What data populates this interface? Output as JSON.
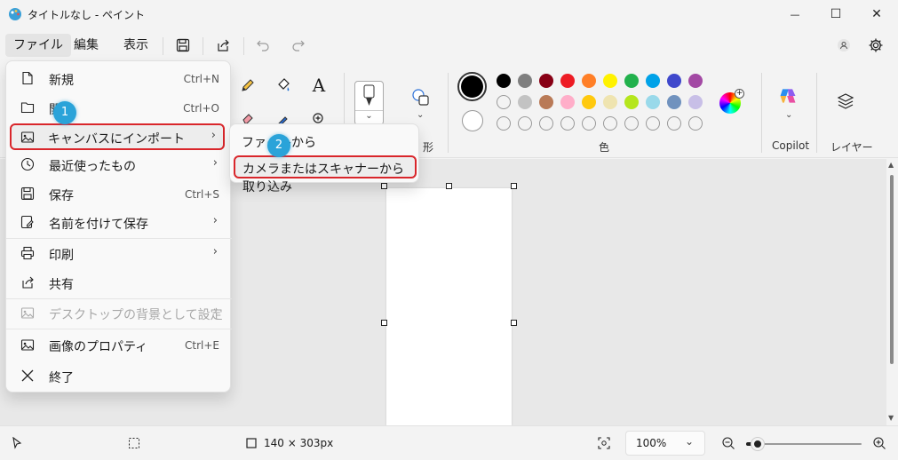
{
  "window": {
    "title": "タイトルなし - ペイント",
    "minimize_glyph": "—",
    "maximize_glyph": "☐",
    "close_glyph": "✕"
  },
  "menubar": {
    "file": "ファイル",
    "edit": "編集",
    "view": "表示"
  },
  "file_menu": {
    "items": [
      {
        "label": "新規",
        "shortcut": "Ctrl+N",
        "icon": "new-file-icon"
      },
      {
        "label": "開く",
        "shortcut": "Ctrl+O",
        "icon": "open-folder-icon"
      },
      {
        "label": "キャンバスにインポート",
        "shortcut": "",
        "icon": "import-image-icon",
        "submenu": true
      },
      {
        "label": "最近使ったもの",
        "shortcut": "",
        "icon": "clock-icon",
        "submenu": true
      },
      {
        "label": "保存",
        "shortcut": "Ctrl+S",
        "icon": "save-icon"
      },
      {
        "label": "名前を付けて保存",
        "shortcut": "",
        "icon": "save-as-icon",
        "submenu": true
      },
      {
        "label": "印刷",
        "shortcut": "",
        "icon": "print-icon",
        "submenu": true
      },
      {
        "label": "共有",
        "shortcut": "",
        "icon": "share-icon"
      },
      {
        "label": "デスクトップの背景として設定",
        "shortcut": "",
        "icon": "desktop-background-icon",
        "submenu": true,
        "disabled": true
      },
      {
        "label": "画像のプロパティ",
        "shortcut": "Ctrl+E",
        "icon": "image-properties-icon"
      },
      {
        "label": "終了",
        "shortcut": "",
        "icon": "close-icon"
      }
    ],
    "arrow_glyph": "›"
  },
  "import_submenu": {
    "from_file": "ファイルから",
    "from_camera": "カメラまたはスキャナーから取り込み"
  },
  "badges": {
    "step1": "1",
    "step2": "2"
  },
  "ribbon": {
    "shapes_label": "形",
    "colors_label": "色",
    "copilot_label": "Copilot",
    "layers_label": "レイヤー",
    "text_tool_glyph": "A"
  },
  "palette": {
    "row1": [
      "#000000",
      "#7f7f7f",
      "#880015",
      "#ed1c24",
      "#ff7f27",
      "#fff200",
      "#22b14c",
      "#00a2e8",
      "#3f48cc",
      "#a349a4"
    ],
    "row2": [
      "",
      "#c3c3c3",
      "#b97a57",
      "#ffaec9",
      "#ffc90e",
      "#efe4b0",
      "#b5e61d",
      "#99d9ea",
      "#7092be",
      "#c8bfe7"
    ],
    "row3": [
      "",
      "",
      "",
      "",
      "",
      "",
      "",
      "",
      "",
      ""
    ]
  },
  "statusbar": {
    "canvas_size": "140 × 303px",
    "zoom": "100%",
    "zoom_level": 0.1
  }
}
